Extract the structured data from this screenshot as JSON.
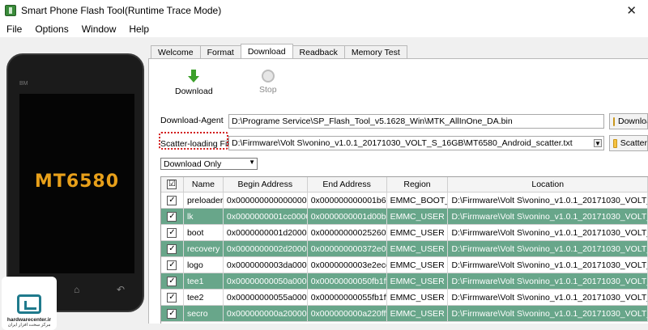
{
  "window": {
    "title": "Smart Phone Flash Tool(Runtime Trace Mode)",
    "close_glyph": "✕"
  },
  "menu": [
    "File",
    "Options",
    "Window",
    "Help"
  ],
  "phone": {
    "brand": "BM",
    "chip": "MT6580",
    "keys": [
      "⊓",
      "⌂",
      "↶"
    ]
  },
  "logo": {
    "name": "hardwarecenter.ir",
    "tagline": "مرکز سخت افزار ایران"
  },
  "tabs": [
    "Welcome",
    "Format",
    "Download",
    "Readback",
    "Memory Test"
  ],
  "active_tab": "Download",
  "toolbar": {
    "download_label": "Download",
    "stop_label": "Stop"
  },
  "download_agent": {
    "label": "Download-Agent",
    "value": "D:\\Programe Service\\SP_Flash_Tool_v5.1628_Win\\MTK_AllInOne_DA.bin",
    "button": "Download"
  },
  "scatter": {
    "label": "Scatter-loading File",
    "value": "D:\\Firmware\\Volt S\\vonino_v1.0.1_20171030_VOLT_S_16GB\\MT6580_Android_scatter.txt",
    "button": "Scatter"
  },
  "mode": {
    "selected": "Download Only"
  },
  "table": {
    "headers": [
      "☑",
      "Name",
      "Begin Address",
      "End Address",
      "Region",
      "Location"
    ],
    "rows": [
      {
        "name": "preloader",
        "begin": "0x0000000000000000",
        "end": "0x000000000001b6b7",
        "region": "EMMC_BOOT_1",
        "location": "D:\\Firmware\\Volt S\\vonino_v1.0.1_20171030_VOLT_S_1",
        "checked": "✓"
      },
      {
        "name": "lk",
        "begin": "0x0000000001cc0000",
        "end": "0x0000000001d00b5f",
        "region": "EMMC_USER",
        "location": "D:\\Firmware\\Volt S\\vonino_v1.0.1_20171030_VOLT_S_1",
        "checked": "✓"
      },
      {
        "name": "boot",
        "begin": "0x0000000001d20000",
        "end": "0x00000000025260ff",
        "region": "EMMC_USER",
        "location": "D:\\Firmware\\Volt S\\vonino_v1.0.1_20171030_VOLT_S_1",
        "checked": "✓"
      },
      {
        "name": "recovery",
        "begin": "0x0000000002d20000",
        "end": "0x000000000372e0ff",
        "region": "EMMC_USER",
        "location": "D:\\Firmware\\Volt S\\vonino_v1.0.1_20171030_VOLT_S_1",
        "checked": "✓"
      },
      {
        "name": "logo",
        "begin": "0x0000000003da0000",
        "end": "0x0000000003e2eccf",
        "region": "EMMC_USER",
        "location": "D:\\Firmware\\Volt S\\vonino_v1.0.1_20171030_VOLT_S_1",
        "checked": "✓"
      },
      {
        "name": "tee1",
        "begin": "0x00000000050a0000",
        "end": "0x00000000050fb1ff",
        "region": "EMMC_USER",
        "location": "D:\\Firmware\\Volt S\\vonino_v1.0.1_20171030_VOLT_S_1",
        "checked": "✓"
      },
      {
        "name": "tee2",
        "begin": "0x00000000055a0000",
        "end": "0x00000000055fb1ff",
        "region": "EMMC_USER",
        "location": "D:\\Firmware\\Volt S\\vonino_v1.0.1_20171030_VOLT_S_1",
        "checked": "✓"
      },
      {
        "name": "secro",
        "begin": "0x000000000a200000",
        "end": "0x000000000a220fff",
        "region": "EMMC_USER",
        "location": "D:\\Firmware\\Volt S\\vonino_v1.0.1_20171030_VOLT_S_1",
        "checked": "✓"
      }
    ]
  },
  "colors": {
    "row_alt": "#68a68a",
    "highlight": "#d21a1a",
    "chip": "#e8a01a",
    "download_icon": "#3ca02a"
  }
}
